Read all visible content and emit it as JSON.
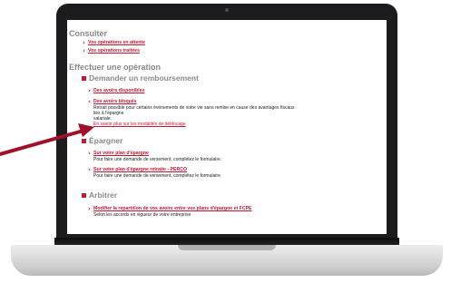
{
  "sections": {
    "consulter": {
      "title": "Consulter",
      "links": [
        "Vos opérations en attente",
        "Vos opérations traitées"
      ]
    },
    "effectuer": {
      "title": "Effectuer une opération"
    },
    "remboursement": {
      "title": "Demander un remboursement",
      "item1": {
        "link": "Des avoirs disponibles"
      },
      "item2": {
        "link": "Des avoirs bloqués",
        "desc1": "Retrait possible pour certains événements de votre vie sans remise en cause des avantages fiscaux liés à l'épargne",
        "desc2": "salariale.",
        "more": "En savoir plus sur les modalités de déblocage"
      }
    },
    "epargner": {
      "title": "Épargner",
      "item1": {
        "link": "Sur votre plan d'épargne",
        "desc": "Pour faire une demande de versement, complétez le formulaire."
      },
      "item2": {
        "link": "Sur votre plan d'épargne retraite - PERCO",
        "desc": "Pour faire une demande de versement, complétez le formulaire."
      }
    },
    "arbitrer": {
      "title": "Arbitrer",
      "item1": {
        "link": "Modifier la répartition de vos avoirs entre vos plans d'épargne et FCPE",
        "desc": "Selon les accords en vigueur de votre entreprise"
      }
    }
  },
  "colors": {
    "accent": "#c21a34",
    "heading": "#8a8a8a",
    "bezel": "#1c1c1e"
  },
  "icons": {
    "bullet": "chevron-right-icon",
    "section": "square-bullet-icon",
    "pointer": "red-arrow"
  }
}
